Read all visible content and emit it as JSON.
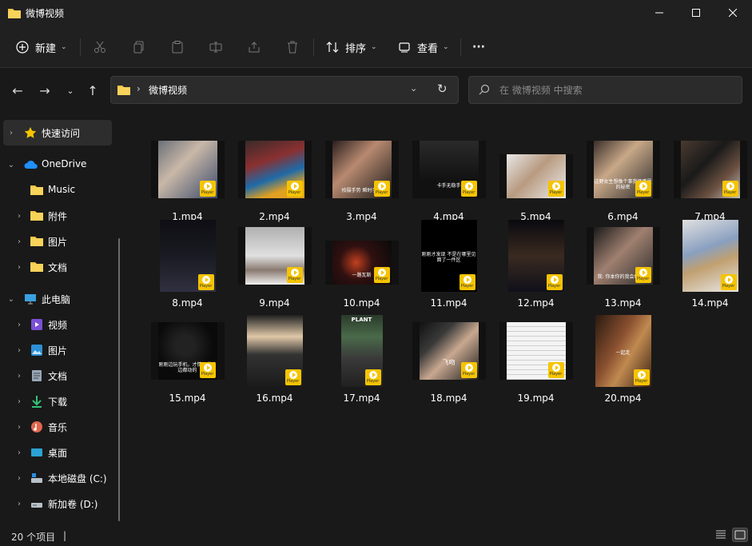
{
  "window": {
    "title": "微博视频"
  },
  "toolbar": {
    "new_label": "新建",
    "sort_label": "排序",
    "view_label": "查看",
    "more_label": "···"
  },
  "address": {
    "path": "微博视频"
  },
  "search": {
    "placeholder": "在 微博视频 中搜索"
  },
  "sidebar": {
    "items": [
      {
        "label": "快速访问",
        "icon": "star-icon"
      },
      {
        "label": "OneDrive",
        "icon": "cloud-icon"
      },
      {
        "label": "Music",
        "icon": "folder-icon"
      },
      {
        "label": "附件",
        "icon": "folder-icon"
      },
      {
        "label": "图片",
        "icon": "folder-icon"
      },
      {
        "label": "文档",
        "icon": "folder-icon"
      },
      {
        "label": "此电脑",
        "icon": "computer-icon"
      },
      {
        "label": "视频",
        "icon": "videos-icon"
      },
      {
        "label": "图片",
        "icon": "pictures-icon"
      },
      {
        "label": "文档",
        "icon": "documents-icon"
      },
      {
        "label": "下载",
        "icon": "download-icon"
      },
      {
        "label": "音乐",
        "icon": "music-icon"
      },
      {
        "label": "桌面",
        "icon": "desktop-icon"
      },
      {
        "label": "本地磁盘 (C:)",
        "icon": "drive-icon"
      },
      {
        "label": "新加卷 (D:)",
        "icon": "drive-icon"
      }
    ]
  },
  "badge_text": "Player",
  "files": [
    {
      "name": "1.mp4",
      "overlay": ""
    },
    {
      "name": "2.mp4",
      "overlay": ""
    },
    {
      "name": "3.mp4",
      "overlay": "拍摄手势    瞬时手法"
    },
    {
      "name": "4.mp4",
      "overlay": "卡手无稳手"
    },
    {
      "name": "5.mp4",
      "overlay": ""
    },
    {
      "name": "6.mp4",
      "overlay": "这野女生想像个事我俩嘴里的秘密"
    },
    {
      "name": "7.mp4",
      "overlay": ""
    },
    {
      "name": "8.mp4",
      "overlay": ""
    },
    {
      "name": "9.mp4",
      "overlay": ""
    },
    {
      "name": "10.mp4",
      "overlay": "一路瓦斯"
    },
    {
      "name": "11.mp4",
      "overlay": "刚刚才发现 不是在哪里见面了一件区"
    },
    {
      "name": "12.mp4",
      "overlay": ""
    },
    {
      "name": "13.mp4",
      "overlay": "我: 你本你的我会帮忙的"
    },
    {
      "name": "14.mp4",
      "overlay": ""
    },
    {
      "name": "15.mp4",
      "overlay": "刚刚边玩手机，才情间我这边都动的"
    },
    {
      "name": "16.mp4",
      "overlay": ""
    },
    {
      "name": "17.mp4",
      "overlay": "PLANT"
    },
    {
      "name": "18.mp4",
      "overlay": "飞吻"
    },
    {
      "name": "19.mp4",
      "overlay": ""
    },
    {
      "name": "20.mp4",
      "overlay": "一起走"
    }
  ],
  "status": {
    "count": "20 个项目",
    "separator": "|"
  }
}
